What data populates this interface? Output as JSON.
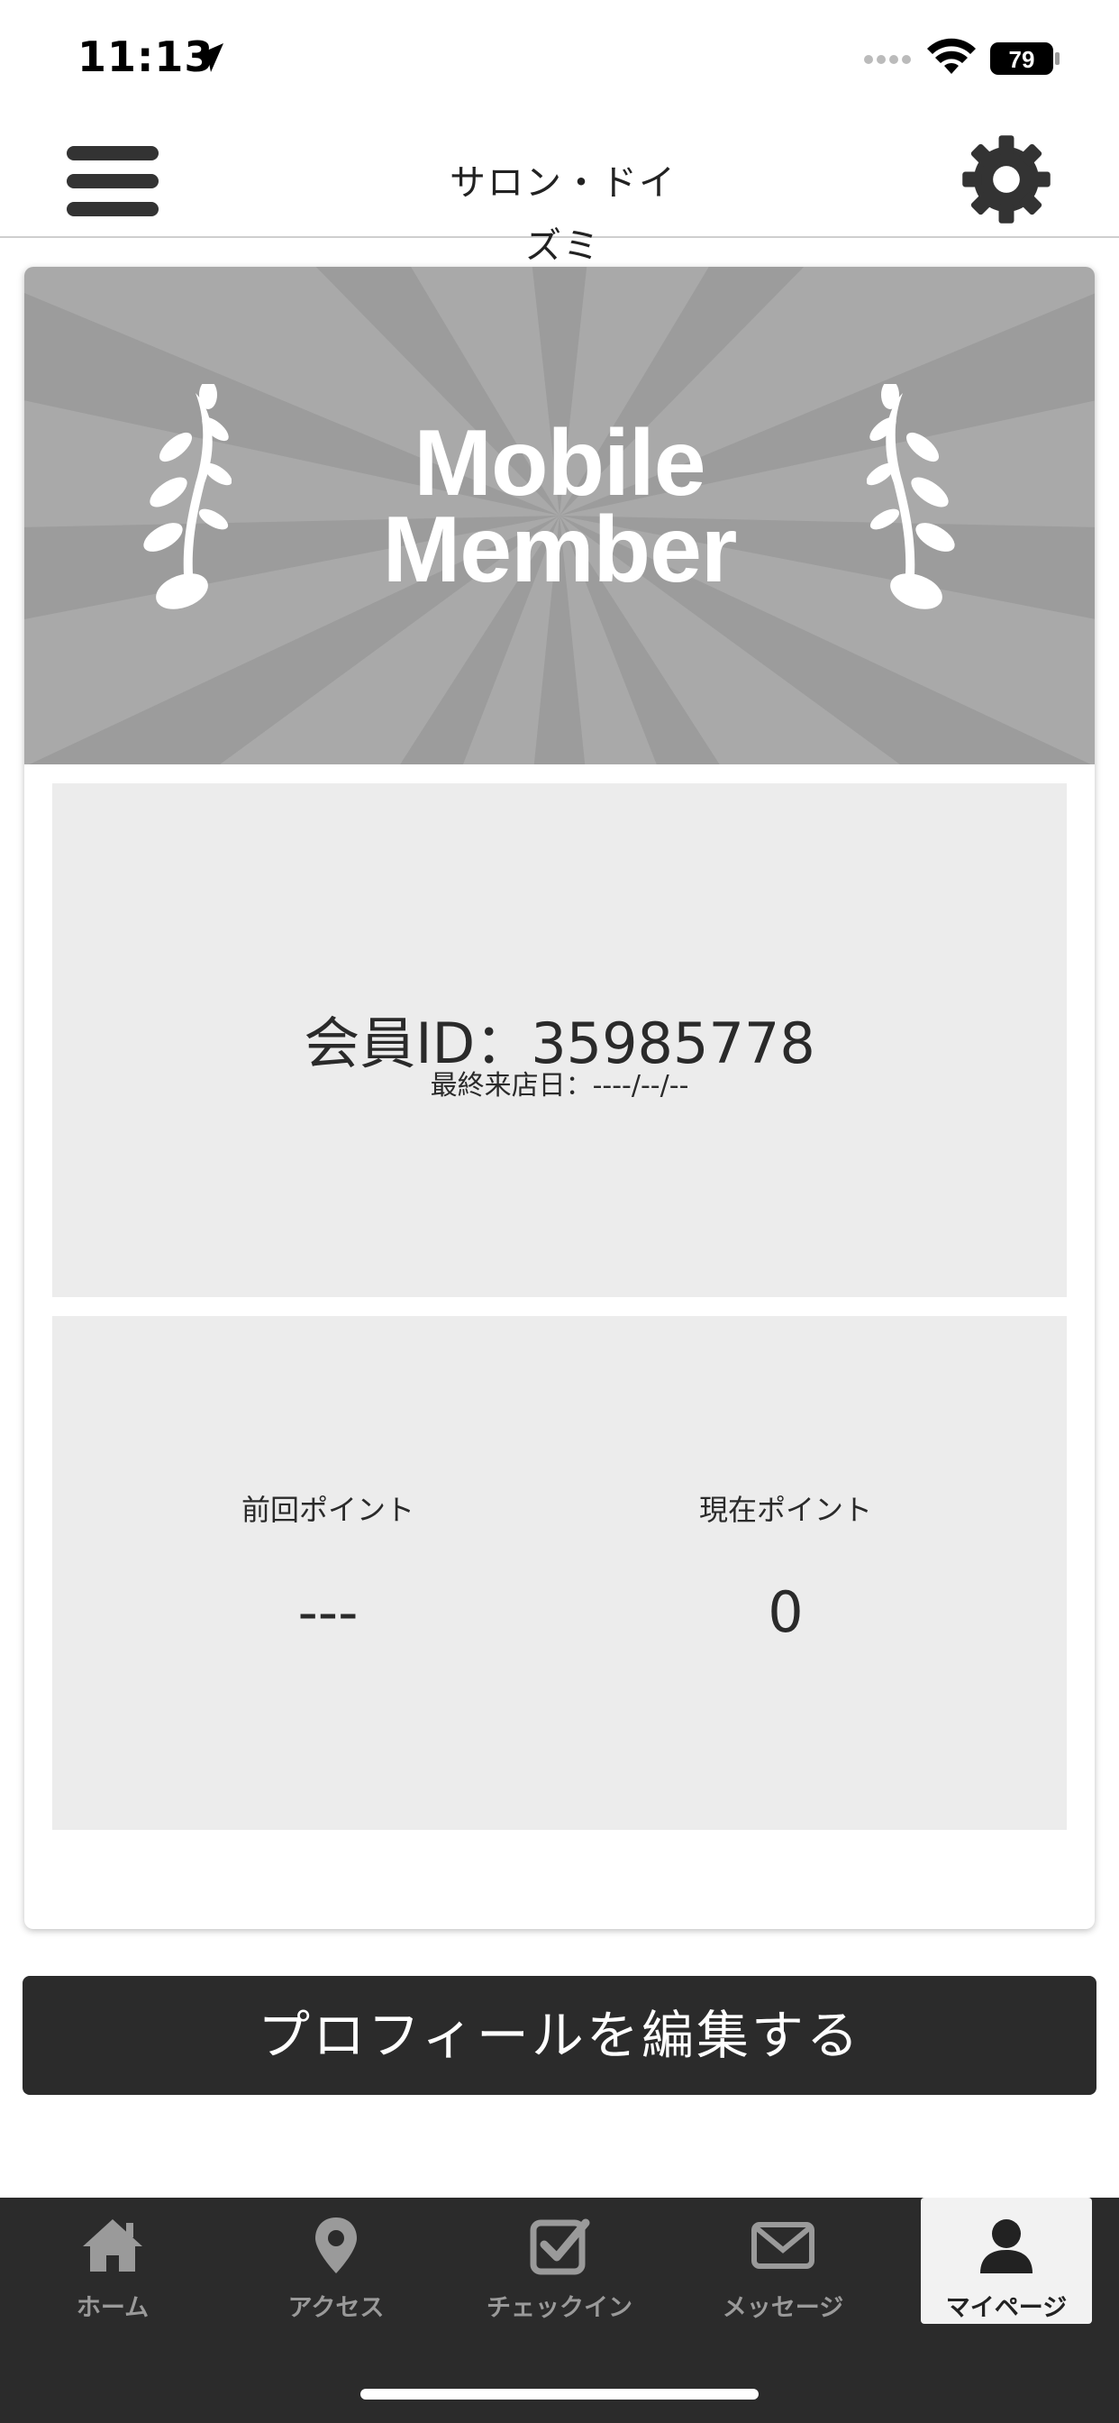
{
  "status_bar": {
    "time": "11:13",
    "battery": "79"
  },
  "header": {
    "app_title": "サロン・ドイズミ",
    "menu_icon": "hamburger-menu-icon",
    "settings_icon": "gear-icon"
  },
  "membership": {
    "card_title_line1": "Mobile",
    "card_title_line2": "Member",
    "member_id_text": "会員ID：35985778",
    "last_visit_text": "最終来店日：----/--/--"
  },
  "points": {
    "previous_label": "前回ポイント",
    "previous_value": "---",
    "current_label": "現在ポイント",
    "current_value": "0"
  },
  "actions": {
    "edit_profile_label": "プロフィールを編集する"
  },
  "tabbar": {
    "items": [
      {
        "label": "ホーム",
        "icon": "home-icon"
      },
      {
        "label": "アクセス",
        "icon": "map-pin-icon"
      },
      {
        "label": "チェックイン",
        "icon": "checkbox-icon"
      },
      {
        "label": "メッセージ",
        "icon": "envelope-icon"
      },
      {
        "label": "マイページ",
        "icon": "user-icon",
        "active": true
      }
    ]
  },
  "colors": {
    "dark": "#2b2b2b",
    "banner_gray": "#a9a9a9",
    "panel_gray": "#ececec"
  }
}
